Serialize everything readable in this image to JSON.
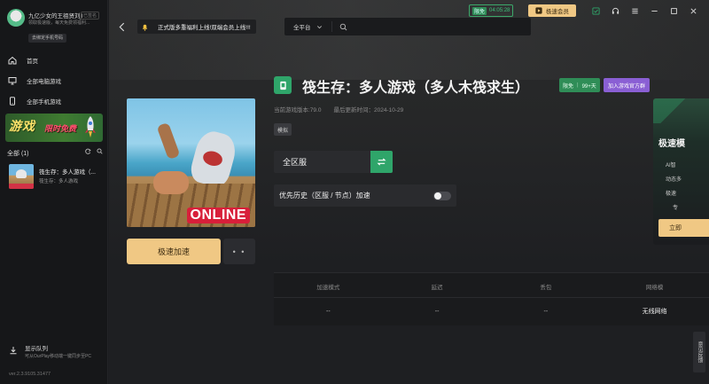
{
  "sidebar": {
    "username": "九亿少女的王祖贤刘jl",
    "user_tag": "已签名",
    "user_sub": "领取极速版，每天免费领福利...",
    "bind_phone": "去绑定手机号码",
    "nav": [
      {
        "label": "首页",
        "icon": "home-icon"
      },
      {
        "label": "全部电脑游戏",
        "icon": "monitor-icon"
      },
      {
        "label": "全部手机游戏",
        "icon": "phone-icon"
      }
    ],
    "promo": {
      "title": "游戏",
      "subtitle": "限时免费"
    },
    "all_count": "全部 (1)",
    "games": [
      {
        "name": "筏生存：多人游戏（...",
        "desc": "筏生存：多人游戏"
      }
    ],
    "display_queue": {
      "title": "显示队列",
      "subtitle": "可从OurPlay移动端一键同步至PC"
    },
    "version": "ver.2.3.9105.31477"
  },
  "topbar": {
    "notice": "正式版多重福利上线!双端会员上线!!!",
    "platform": "全平台",
    "search_placeholder": "",
    "vip_timer_label": "限免",
    "vip_timer": "04:05:28",
    "vip_button": "极速会员"
  },
  "game": {
    "title": "筏生存：多人游戏（多人木筏求生）",
    "free_badge": "限免",
    "free_days": "99+天",
    "join_group": "加入游戏官方群",
    "version_label": "当前游戏版本:79.0",
    "updated_label": "最后更新时间：2024-10-29",
    "tag": "模拟",
    "cover_banner": "ONLINE",
    "accelerate": "极速加速",
    "more": "• •",
    "server": "全区服",
    "priority": "优先历史（区服 / 节点）加速",
    "priority_on": false
  },
  "stats": {
    "headers": [
      "加速模式",
      "延迟",
      "丢包",
      "网络模"
    ],
    "values": [
      "--",
      "--",
      "--",
      "无线网络"
    ]
  },
  "promo_card": {
    "title": "极速模",
    "lines": [
      "AI智",
      "动态多",
      "极速",
      "专"
    ],
    "button": "立即"
  },
  "feedback": "意见反馈",
  "colors": {
    "accent_green": "#2fa56a",
    "gold": "#f0c884",
    "purple": "#8a5fd4"
  }
}
